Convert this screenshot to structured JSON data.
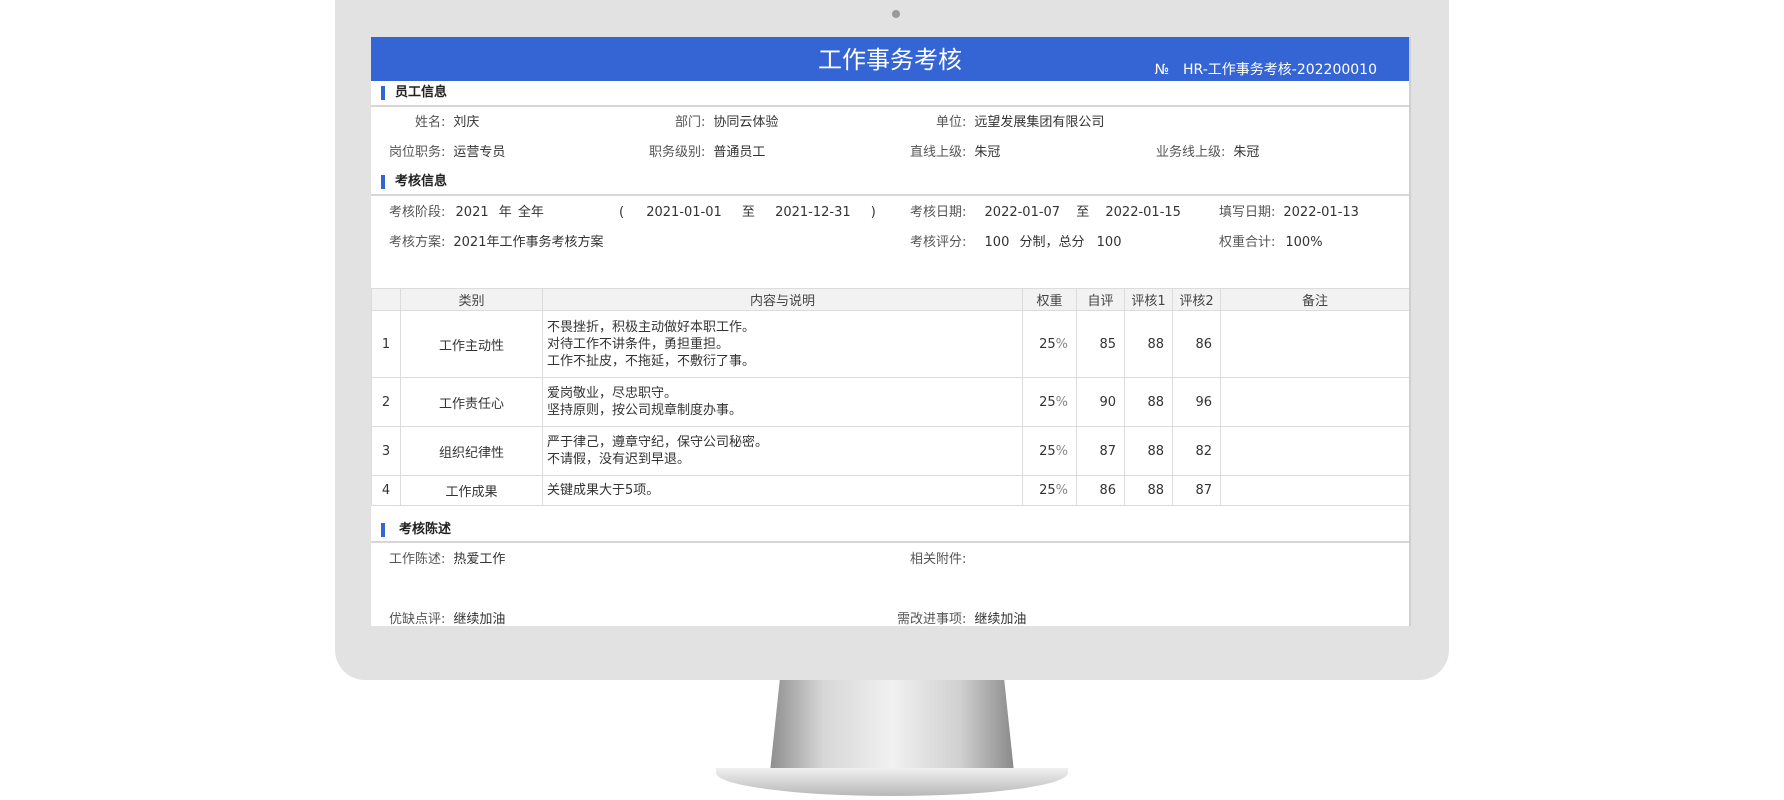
{
  "form": {
    "title": "工作事务考核",
    "doc_no_label": "№",
    "doc_no": "HR-工作事务考核-202200010"
  },
  "employee": {
    "section_title": "员工信息",
    "name_label": "姓名:",
    "name": "刘庆",
    "dept_label": "部门:",
    "dept": "协同云体验",
    "unit_label": "单位:",
    "unit": "远望发展集团有限公司",
    "post_label": "岗位职务:",
    "post": "运营专员",
    "rank_label": "职务级别:",
    "rank": "普通员工",
    "direct_label": "直线上级:",
    "direct": "朱冠",
    "biz_label": "业务线上级:",
    "biz": "朱冠"
  },
  "assessment": {
    "section_title": "考核信息",
    "stage_label": "考核阶段:",
    "year": "2021",
    "year_unit": "年",
    "period": "全年",
    "paren_open": "(",
    "stage_start": "2021-01-01",
    "to1": "至",
    "stage_end": "2021-12-31",
    "paren_close": ")",
    "date_label": "考核日期:",
    "date_start": "2022-01-07",
    "to2": "至",
    "date_end": "2022-01-15",
    "fill_label": "填写日期:",
    "fill_date": "2022-01-13",
    "plan_label": "考核方案:",
    "plan": "2021年工作事务考核方案",
    "score_label": "考核评分:",
    "score_mode": "100",
    "score_mid": "分制，总分",
    "score_total": "100",
    "weight_label": "权重合计:",
    "weight_total": "100%"
  },
  "table": {
    "headers": [
      "",
      "类别",
      "内容与说明",
      "权重",
      "自评",
      "评核1",
      "评核2",
      "备注"
    ],
    "percent_sign": "%",
    "rows": [
      {
        "no": "1",
        "category": "工作主动性",
        "desc": [
          "不畏挫折，积极主动做好本职工作。",
          "对待工作不讲条件，勇担重担。",
          "工作不扯皮，不拖延，不敷衍了事。"
        ],
        "weight": "25",
        "self": "85",
        "r1": "88",
        "r2": "86",
        "remark": ""
      },
      {
        "no": "2",
        "category": "工作责任心",
        "desc": [
          "爱岗敬业，尽忠职守。",
          "坚持原则，按公司规章制度办事。"
        ],
        "weight": "25",
        "self": "90",
        "r1": "88",
        "r2": "96",
        "remark": ""
      },
      {
        "no": "3",
        "category": "组织纪律性",
        "desc": [
          "严于律己，遵章守纪，保守公司秘密。",
          "不请假，没有迟到早退。"
        ],
        "weight": "25",
        "self": "87",
        "r1": "88",
        "r2": "82",
        "remark": ""
      },
      {
        "no": "4",
        "category": "工作成果",
        "desc": [
          "关键成果大于5项。"
        ],
        "weight": "25",
        "self": "86",
        "r1": "88",
        "r2": "87",
        "remark": ""
      }
    ]
  },
  "statement": {
    "section_title": "考核陈述",
    "work_label": "工作陈述:",
    "work": "热爱工作",
    "attach_label": "相关附件:",
    "attach": "",
    "review_label": "优缺点评:",
    "review": "继续加油",
    "improve_label": "需改进事项:",
    "improve": "继续加油"
  }
}
